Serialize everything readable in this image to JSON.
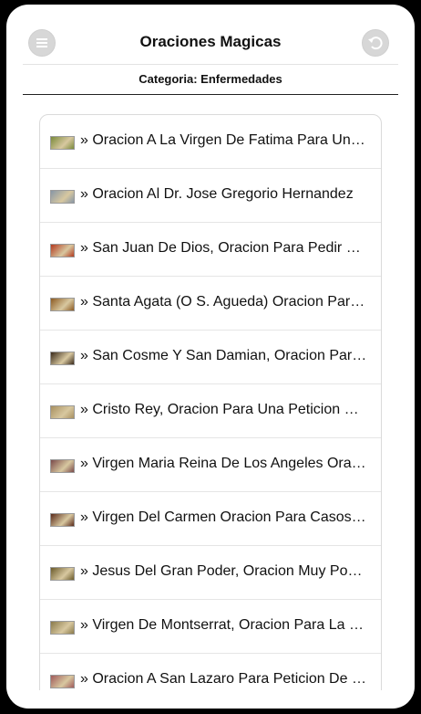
{
  "header": {
    "title": "Oraciones Magicas",
    "menu_icon": "menu-icon",
    "back_icon": "back-icon"
  },
  "subheader": {
    "category": "Categoria: Enfermedades"
  },
  "list": {
    "items": [
      {
        "label": "» Oracion A La Virgen De Fatima Para Una Peticion",
        "thumb_color": "#7a8a3a"
      },
      {
        "label": "» Oracion Al Dr. Jose Gregorio Hernandez",
        "thumb_color": "#8796a6"
      },
      {
        "label": "» San Juan De Dios, Oracion Para Pedir Salud",
        "thumb_color": "#b33a1f"
      },
      {
        "label": "» Santa Agata (O S. Agueda) Oracion Para La Salud",
        "thumb_color": "#8c5a22"
      },
      {
        "label": "» San Cosme Y San Damian, Oracion Para La Salud",
        "thumb_color": "#3a2a1a"
      },
      {
        "label": "» Cristo Rey, Oracion Para Una Peticion Dificil",
        "thumb_color": "#a89060"
      },
      {
        "label": "» Virgen Maria Reina De Los Angeles Oracion",
        "thumb_color": "#7a4a4a"
      },
      {
        "label": "» Virgen Del Carmen Oracion Para Casos Dificiles",
        "thumb_color": "#5a2a1a"
      },
      {
        "label": "» Jesus Del Gran Poder, Oracion Muy Poderosa",
        "thumb_color": "#6a5a2a"
      },
      {
        "label": "» Virgen De Montserrat, Oracion Para La Salud",
        "thumb_color": "#8a7a4a"
      },
      {
        "label": "» Oracion A San Lazaro Para Peticion De Salud",
        "thumb_color": "#a05a5a"
      }
    ]
  }
}
